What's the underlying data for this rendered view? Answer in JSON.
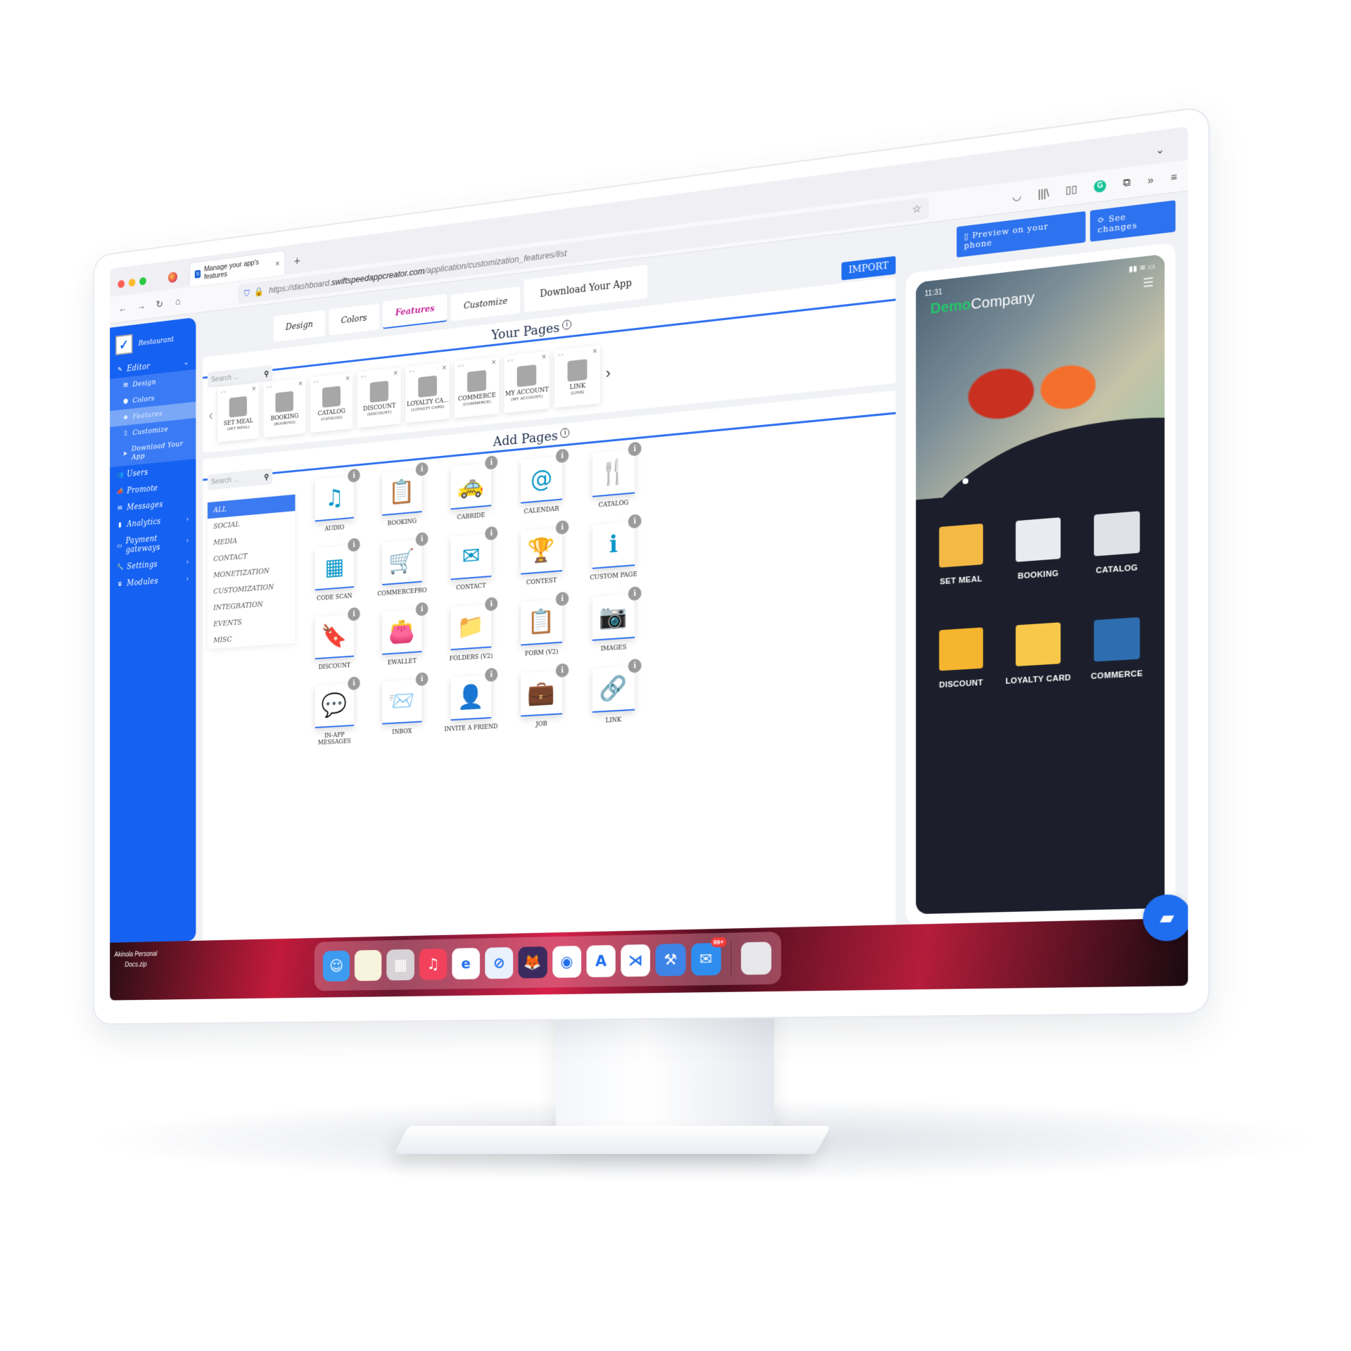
{
  "browser": {
    "tab_title": "Manage your app's features",
    "tab_favicon": "S",
    "new_tab_label": "+",
    "url_prefix": "https://dashboard.",
    "url_host": "swiftspeedappcreator.com",
    "url_path": "/application/customization_features/list",
    "traffic_colors": [
      "#fe5f57",
      "#febc2e",
      "#28c840"
    ]
  },
  "sidebar": {
    "app_name": "Restaurant",
    "items": [
      {
        "label": "Editor",
        "icon": "pencil-icon"
      },
      {
        "label": "Users",
        "icon": "users-icon"
      },
      {
        "label": "Promote",
        "icon": "megaphone-icon"
      },
      {
        "label": "Messages",
        "icon": "envelope-icon"
      },
      {
        "label": "Analytics",
        "icon": "chart-icon"
      },
      {
        "label": "Payment gateways",
        "icon": "credit-card-icon"
      },
      {
        "label": "Settings",
        "icon": "wrench-icon"
      },
      {
        "label": "Modules",
        "icon": "cubes-icon"
      }
    ],
    "editor_sub": [
      {
        "label": "Design"
      },
      {
        "label": "Colors"
      },
      {
        "label": "Features"
      },
      {
        "label": "Customize"
      },
      {
        "label": "Download Your App"
      }
    ]
  },
  "top_tabs": [
    "Design",
    "Colors",
    "Features",
    "Customize",
    "Download Your App"
  ],
  "import_label": "IMPORT",
  "your_pages": {
    "title": "Your Pages",
    "search_placeholder": "Search ...",
    "items": [
      {
        "name": "SET MEAL",
        "sub": "(SET MEAL)"
      },
      {
        "name": "BOOKING",
        "sub": "(BOOKING)"
      },
      {
        "name": "CATALOG",
        "sub": "(CATALOG)"
      },
      {
        "name": "DISCOUNT",
        "sub": "(DISCOUNT)"
      },
      {
        "name": "LOYALTY CA...",
        "sub": "(LOYALTY CARD)"
      },
      {
        "name": "COMMERCE",
        "sub": "(COMMERCE)"
      },
      {
        "name": "MY ACCOUNT",
        "sub": "(MY ACCOUNT)"
      },
      {
        "name": "LINK",
        "sub": "(LINK)"
      }
    ]
  },
  "add_pages": {
    "title": "Add Pages",
    "search_placeholder": "Search ...",
    "categories": [
      "ALL",
      "SOCIAL",
      "MEDIA",
      "CONTACT",
      "MONETIZATION",
      "CUSTOMIZATION",
      "INTEGRATION",
      "EVENTS",
      "MISC"
    ],
    "features": [
      {
        "label": "AUDIO",
        "glyph": "♫"
      },
      {
        "label": "BOOKING",
        "glyph": "📋"
      },
      {
        "label": "CABRIDE",
        "glyph": "🚕"
      },
      {
        "label": "CALENDAR",
        "glyph": "@"
      },
      {
        "label": "CATALOG",
        "glyph": "🍴"
      },
      {
        "label": "CODE SCAN",
        "glyph": "▦"
      },
      {
        "label": "COMMERCEPRO",
        "glyph": "🛒"
      },
      {
        "label": "CONTACT",
        "glyph": "✉"
      },
      {
        "label": "CONTEST",
        "glyph": "🏆"
      },
      {
        "label": "CUSTOM PAGE",
        "glyph": "ℹ"
      },
      {
        "label": "DISCOUNT",
        "glyph": "🔖"
      },
      {
        "label": "EWALLET",
        "glyph": "👛"
      },
      {
        "label": "FOLDERS (V2)",
        "glyph": "📁"
      },
      {
        "label": "FORM (V2)",
        "glyph": "📋"
      },
      {
        "label": "IMAGES",
        "glyph": "📷"
      },
      {
        "label": "IN-APP MESSAGES",
        "glyph": "💬"
      },
      {
        "label": "INBOX",
        "glyph": "📨"
      },
      {
        "label": "INVITE A FRIEND",
        "glyph": "👤"
      },
      {
        "label": "JOB",
        "glyph": "💼"
      },
      {
        "label": "LINK",
        "glyph": "🔗"
      }
    ],
    "info_badge": "i"
  },
  "preview": {
    "preview_phone_label": "Preview on your phone",
    "see_changes_label": "See changes",
    "status_time": "11:31",
    "status_icons": "▮▮ ≋ ▭",
    "logo_demo": "Demo",
    "logo_company": "Company",
    "grid": [
      {
        "label": "SET MEAL",
        "color": "#f4b844"
      },
      {
        "label": "BOOKING",
        "color": "#e8ebef"
      },
      {
        "label": "CATALOG",
        "color": "#dfe3e8"
      },
      {
        "label": "DISCOUNT",
        "color": "#f5b52e"
      },
      {
        "label": "LOYALTY CARD",
        "color": "#f8c84a"
      },
      {
        "label": "COMMERCE",
        "color": "#2e6db0"
      }
    ]
  },
  "desktop": {
    "file_line1": "Akinola Personal",
    "file_line2": "Docs.zip",
    "dock": [
      {
        "name": "finder",
        "color": "#3d9bf0",
        "glyph": "☺"
      },
      {
        "name": "notes",
        "color": "#f8f3dc",
        "glyph": ""
      },
      {
        "name": "launchpad",
        "color": "#d7d2d6",
        "glyph": "▦"
      },
      {
        "name": "music",
        "color": "#f2425b",
        "glyph": "♫"
      },
      {
        "name": "edge",
        "color": "#ffffff",
        "glyph": "e"
      },
      {
        "name": "safari",
        "color": "#e9f1fb",
        "glyph": "⊘"
      },
      {
        "name": "firefox",
        "color": "#3b2a5e",
        "glyph": "🦊"
      },
      {
        "name": "chrome",
        "color": "#ffffff",
        "glyph": "◉"
      },
      {
        "name": "android-studio",
        "color": "#ffffff",
        "glyph": "A"
      },
      {
        "name": "vscode",
        "color": "#ffffff",
        "glyph": "⋊"
      },
      {
        "name": "xcode",
        "color": "#3d84e6",
        "glyph": "⚒"
      },
      {
        "name": "mail",
        "color": "#2f8df0",
        "glyph": "✉",
        "badge": "99+"
      }
    ],
    "trash": {
      "name": "trash",
      "color": "#e7e7ea"
    }
  }
}
